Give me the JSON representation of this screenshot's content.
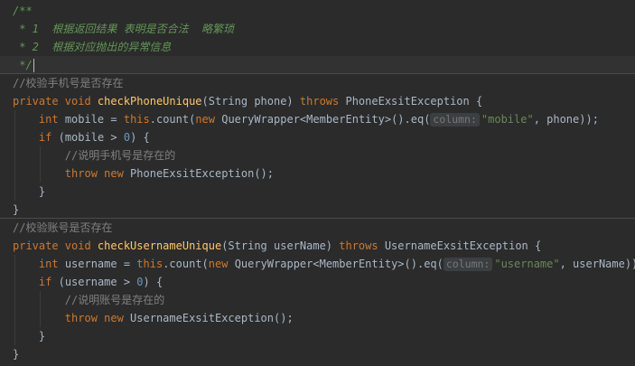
{
  "editor": {
    "lines": [
      {
        "id": "doc-open",
        "tokens": [
          [
            "doc",
            "/**"
          ]
        ]
      },
      {
        "id": "doc-line-1",
        "tokens": [
          [
            "doc",
            " * 1  根据返回结果 表明是否合法  略繁琐"
          ]
        ]
      },
      {
        "id": "doc-line-2",
        "tokens": [
          [
            "doc",
            " * 2  根据对应抛出的异常信息"
          ]
        ]
      },
      {
        "id": "doc-close",
        "tokens": [
          [
            "doc",
            " */"
          ]
        ],
        "current": true,
        "caret": true
      },
      {
        "id": "comment-check-phone",
        "tokens": [
          [
            "cmt",
            "//校验手机号是否存在"
          ]
        ],
        "separator_above": true
      },
      {
        "id": "method-check-phone-unique",
        "tokens": [
          [
            "kw",
            "private void "
          ],
          [
            "fn",
            "checkPhoneUnique"
          ],
          [
            "plain",
            "(String phone) "
          ],
          [
            "kw",
            "throws "
          ],
          [
            "plain",
            "PhoneExsitException {"
          ]
        ]
      },
      {
        "id": "mobile-count-statement",
        "tokens": [
          [
            "plain",
            "    "
          ],
          [
            "kw",
            "int "
          ],
          [
            "plain",
            "mobile = "
          ],
          [
            "kw",
            "this"
          ],
          [
            "plain",
            ".count("
          ],
          [
            "kw",
            "new "
          ],
          [
            "plain",
            "QueryWrapper<MemberEntity>().eq("
          ],
          [
            "hint",
            "column:"
          ],
          [
            "str",
            "\"mobile\""
          ],
          [
            "plain",
            ", phone));"
          ]
        ]
      },
      {
        "id": "if-mobile-positive",
        "tokens": [
          [
            "plain",
            "    "
          ],
          [
            "kw",
            "if "
          ],
          [
            "plain",
            "(mobile > "
          ],
          [
            "num",
            "0"
          ],
          [
            "plain",
            ") {"
          ]
        ]
      },
      {
        "id": "comment-phone-exists",
        "tokens": [
          [
            "plain",
            "        "
          ],
          [
            "cmt",
            "//说明手机号是存在的"
          ]
        ]
      },
      {
        "id": "throw-phone-exception",
        "tokens": [
          [
            "plain",
            "        "
          ],
          [
            "kw",
            "throw new "
          ],
          [
            "plain",
            "PhoneExsitException();"
          ]
        ]
      },
      {
        "id": "close-if-1",
        "tokens": [
          [
            "plain",
            "    }"
          ]
        ]
      },
      {
        "id": "close-method-1",
        "tokens": [
          [
            "plain",
            "}"
          ]
        ]
      },
      {
        "id": "comment-check-username",
        "tokens": [
          [
            "cmt",
            "//校验账号是否存在"
          ]
        ],
        "separator_above": true
      },
      {
        "id": "method-check-username-unique",
        "tokens": [
          [
            "kw",
            "private void "
          ],
          [
            "fn",
            "checkUsernameUnique"
          ],
          [
            "plain",
            "(String userName) "
          ],
          [
            "kw",
            "throws "
          ],
          [
            "plain",
            "UsernameExsitException {"
          ]
        ]
      },
      {
        "id": "username-count-statement",
        "tokens": [
          [
            "plain",
            "    "
          ],
          [
            "kw",
            "int "
          ],
          [
            "plain",
            "username = "
          ],
          [
            "kw",
            "this"
          ],
          [
            "plain",
            ".count("
          ],
          [
            "kw",
            "new "
          ],
          [
            "plain",
            "QueryWrapper<MemberEntity>().eq("
          ],
          [
            "hint",
            "column:"
          ],
          [
            "str",
            "\"username\""
          ],
          [
            "plain",
            ", userName));"
          ]
        ]
      },
      {
        "id": "if-username-positive",
        "tokens": [
          [
            "plain",
            "    "
          ],
          [
            "kw",
            "if "
          ],
          [
            "plain",
            "(username > "
          ],
          [
            "num",
            "0"
          ],
          [
            "plain",
            ") {"
          ]
        ]
      },
      {
        "id": "comment-username-exists",
        "tokens": [
          [
            "plain",
            "        "
          ],
          [
            "cmt",
            "//说明账号是存在的"
          ]
        ]
      },
      {
        "id": "throw-username-exception",
        "tokens": [
          [
            "plain",
            "        "
          ],
          [
            "kw",
            "throw new "
          ],
          [
            "plain",
            "UsernameExsitException();"
          ]
        ]
      },
      {
        "id": "close-if-2",
        "tokens": [
          [
            "plain",
            "    }"
          ]
        ]
      },
      {
        "id": "close-method-2",
        "tokens": [
          [
            "plain",
            "}"
          ]
        ]
      }
    ]
  },
  "colors": {
    "background": "#2b2b2b",
    "current_line": "#323232",
    "keyword": "#cc7832",
    "method": "#ffc66d",
    "string": "#6a8759",
    "number": "#6897bb",
    "doc_comment": "#629755",
    "line_comment": "#808080",
    "text": "#a9b7c6"
  }
}
